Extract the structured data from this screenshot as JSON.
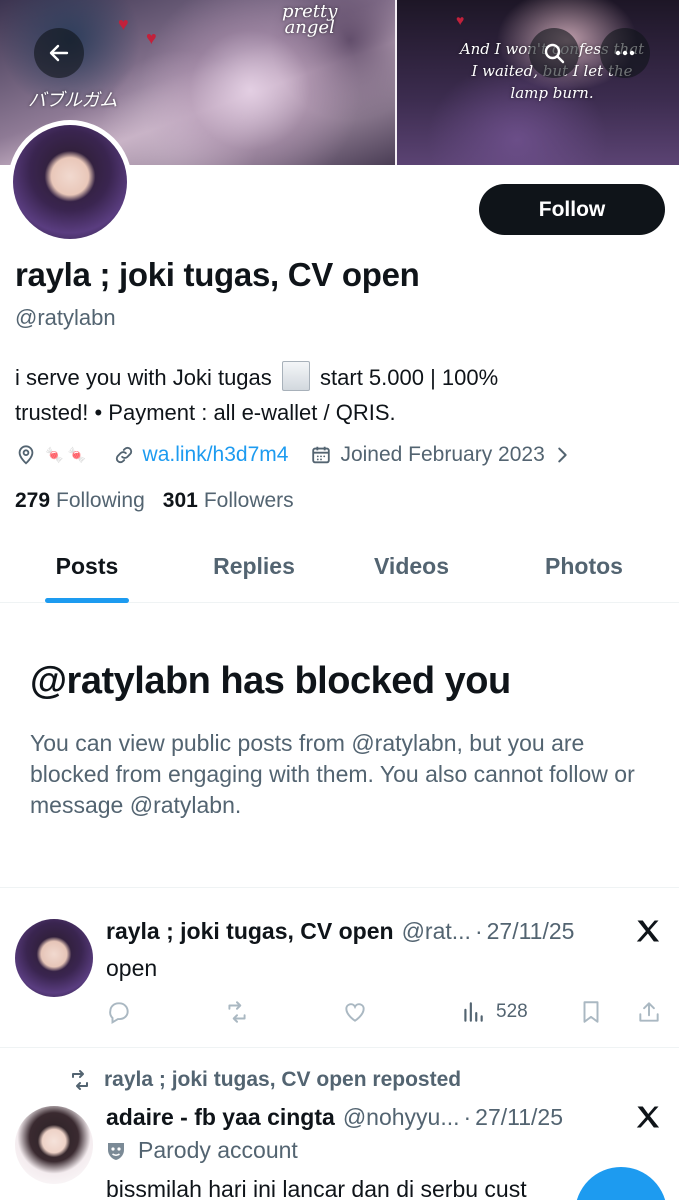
{
  "banner": {
    "text_angel": "pretty\nangel",
    "text_jp": "バブルガム",
    "text_lyric": "And I won't confess that\nI waited, but I let the\nlamp burn."
  },
  "header_buttons": {
    "back_icon": "arrow-left-icon",
    "search_icon": "search-icon",
    "more_icon": "more-dots-icon"
  },
  "profile": {
    "follow_label": "Follow",
    "display_name": "rayla ; joki tugas, CV open",
    "handle": "@ratylabn",
    "bio_part1": "i serve you with Joki tugas",
    "bio_part2": "start 5.000 | 100%",
    "bio_line2": "trusted! • Payment : all e-wallet / QRIS.",
    "location": "🍬 🍬",
    "link": "wa.link/h3d7m4",
    "joined": "Joined February 2023",
    "following_count": "279",
    "following_label": "Following",
    "followers_count": "301",
    "followers_label": "Followers"
  },
  "tabs": [
    {
      "label": "Posts",
      "active": true
    },
    {
      "label": "Replies",
      "active": false
    },
    {
      "label": "Videos",
      "active": false
    },
    {
      "label": "Photos",
      "active": false
    }
  ],
  "blocked": {
    "title": "@ratylabn has blocked you",
    "body": "You can view public posts from @ratylabn, but you are blocked from engaging with them. You also cannot follow or message @ratylabn."
  },
  "posts": [
    {
      "name": "rayla ; joki tugas, CV open",
      "handle": "@rat...",
      "date": "27/11/25",
      "text": "open",
      "views": "528"
    },
    {
      "repost_label": "rayla ; joki tugas, CV open reposted",
      "name": "adaire - fb yaa cingta",
      "handle": "@nohyyu...",
      "date": "27/11/25",
      "parody": "Parody account",
      "text": "bissmilah hari ini lancar dan di serbu cust"
    }
  ],
  "colors": {
    "accent": "#1d9bf0",
    "text": "#0f1419",
    "muted": "#536471"
  }
}
